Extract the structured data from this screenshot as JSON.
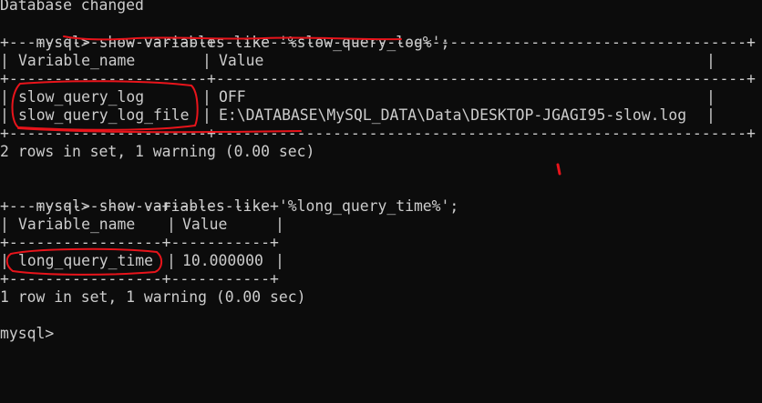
{
  "terminal": {
    "line_db_changed": "Database changed",
    "query1": {
      "prompt": "mysql> ",
      "command": "show variables like '%slow_query_log%';"
    },
    "table1": {
      "border": "+----------------------+-----------------------------------------------------------+",
      "col_name_header": "Variable_name",
      "col_value_header": "Value",
      "rows": [
        {
          "name": "slow_query_log",
          "value": "OFF"
        },
        {
          "name": "slow_query_log_file",
          "value": "E:\\DATABASE\\MySQL_DATA\\Data\\DESKTOP-JGAGI95-slow.log"
        }
      ],
      "summary": "2 rows in set, 1 warning (0.00 sec)"
    },
    "query2": {
      "prompt": "mysql> ",
      "command": "show variables like '%long_query_time%';"
    },
    "table2": {
      "border": "+-----------------+-----------+",
      "col_name_header": "Variable_name",
      "col_value_header": "Value",
      "rows": [
        {
          "name": "long_query_time",
          "value": "10.000000"
        }
      ],
      "summary": "1 row in set, 1 warning (0.00 sec)"
    },
    "final_prompt": "mysql>"
  },
  "colors": {
    "background": "#0c0c0c",
    "text": "#cccccc",
    "annotation": "#e8141b"
  }
}
